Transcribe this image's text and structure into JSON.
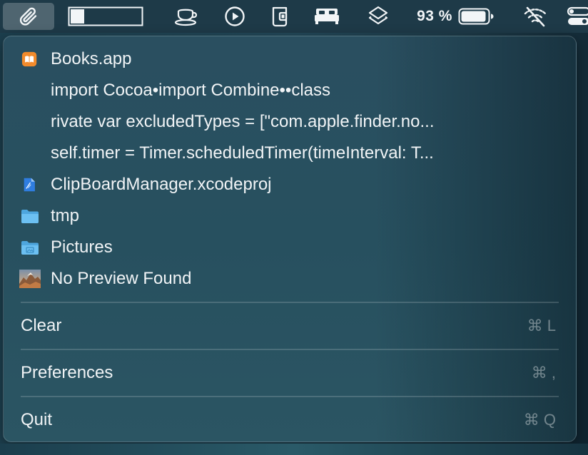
{
  "menubar": {
    "battery_percent": "93 %",
    "icons": [
      "paperclip-icon",
      "progress-bar",
      "coffee-cup-icon",
      "play-circle-icon",
      "phone-tablet-icon",
      "bed-icon",
      "layers-icon",
      "battery-icon",
      "wifi-off-icon",
      "control-center-icon"
    ]
  },
  "menu": {
    "items": [
      {
        "label": "Books.app",
        "icon": "books-app-icon"
      },
      {
        "label": "import Cocoa•import Combine••class"
      },
      {
        "label": "rivate var excludedTypes = [\"com.apple.finder.no..."
      },
      {
        "label": "self.timer = Timer.scheduledTimer(timeInterval: T..."
      },
      {
        "label": "ClipBoardManager.xcodeproj",
        "icon": "xcode-document-icon"
      },
      {
        "label": "tmp",
        "icon": "folder-icon"
      },
      {
        "label": "Pictures",
        "icon": "pictures-folder-icon"
      },
      {
        "label": "No Preview Found",
        "icon": "image-thumbnail-icon"
      }
    ],
    "actions": [
      {
        "label": "Clear",
        "shortcut": "⌘ L"
      },
      {
        "label": "Preferences",
        "shortcut": "⌘ ,"
      },
      {
        "label": "Quit",
        "shortcut": "⌘ Q"
      }
    ]
  },
  "colors": {
    "menubar_bg": "#1e3a48",
    "menu_bg": "#27505f",
    "text": "#f1f4f6",
    "shortcut_text": "#8ea4ad",
    "folder_blue": "#5fb7ee",
    "books_orange": "#f28b2c"
  }
}
